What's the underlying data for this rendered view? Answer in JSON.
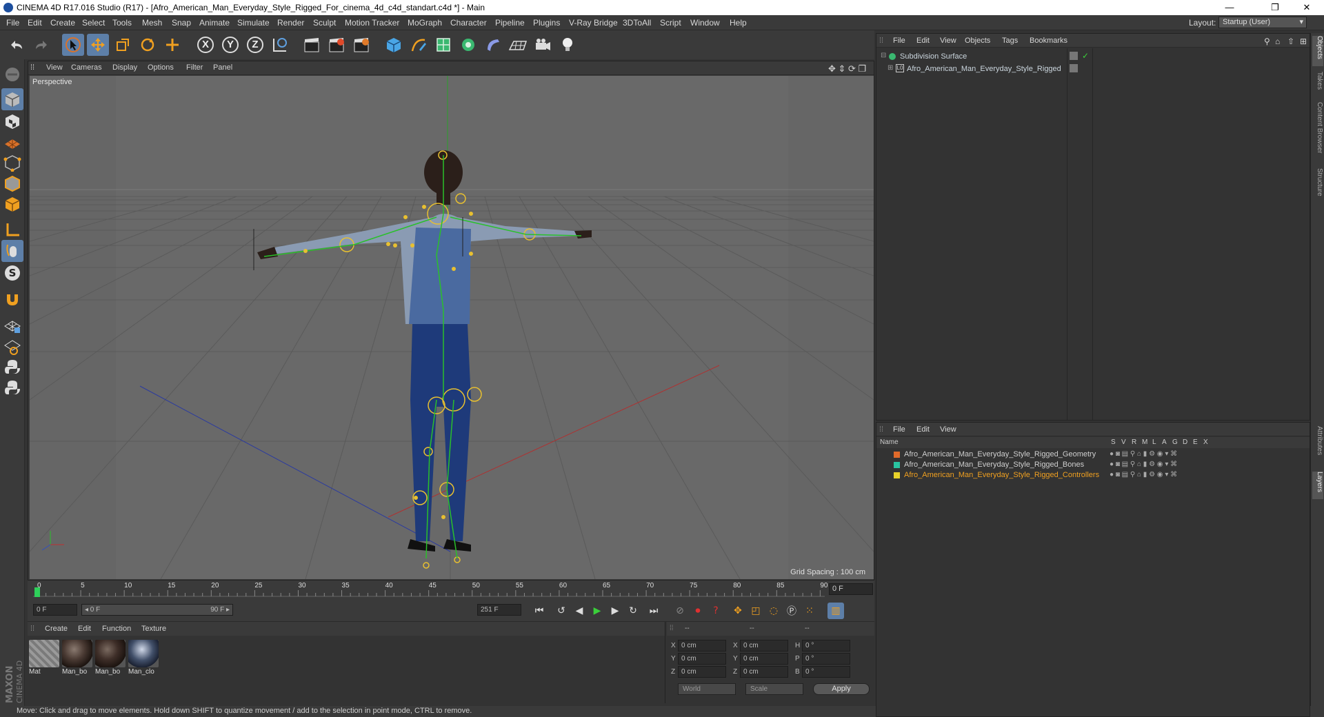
{
  "window": {
    "title": "CINEMA 4D R17.016 Studio (R17) - [Afro_American_Man_Everyday_Style_Rigged_For_cinema_4d_c4d_standart.c4d *] - Main",
    "minimize": "—",
    "maximize": "❐",
    "close": "✕"
  },
  "menubar": {
    "items": [
      "File",
      "Edit",
      "Create",
      "Select",
      "Tools",
      "Mesh",
      "Snap",
      "Animate",
      "Simulate",
      "Render",
      "Sculpt",
      "Motion Tracker",
      "MoGraph",
      "Character",
      "Pipeline",
      "Plugins",
      "V-Ray Bridge",
      "3DToAll",
      "Script",
      "Window",
      "Help"
    ],
    "layout_label": "Layout:",
    "layout_value": "Startup (User)"
  },
  "toolbar": {
    "axis_x": "X",
    "axis_y": "Y",
    "axis_z": "Z"
  },
  "viewport": {
    "menu": [
      "View",
      "Cameras",
      "Display",
      "Options",
      "Filter",
      "Panel"
    ],
    "label": "Perspective",
    "grid_spacing": "Grid Spacing : 100 cm"
  },
  "timeline": {
    "ticks": [
      "0",
      "5",
      "10",
      "15",
      "20",
      "25",
      "30",
      "35",
      "40",
      "45",
      "50",
      "55",
      "60",
      "65",
      "70",
      "75",
      "80",
      "85",
      "90"
    ],
    "current_frame": "0 F"
  },
  "transport": {
    "start_field": "0 F",
    "range_start": "◂ 0 F",
    "range_end": "90 F ▸",
    "end_field": "251 F"
  },
  "materials": {
    "menu": [
      "Create",
      "Edit",
      "Function",
      "Texture"
    ],
    "items": [
      {
        "name": "Mat",
        "color": "#9a9a9a"
      },
      {
        "name": "Man_bo",
        "color": "#4a3a33"
      },
      {
        "name": "Man_bo",
        "color": "#3e2e28"
      },
      {
        "name": "Man_clo",
        "color": "#42506a"
      }
    ]
  },
  "coordinates": {
    "headers": [
      "--",
      "--",
      "--"
    ],
    "rows": [
      {
        "a": "X",
        "av": "0 cm",
        "b": "X",
        "bv": "0 cm",
        "c": "H",
        "cv": "0 °"
      },
      {
        "a": "Y",
        "av": "0 cm",
        "b": "Y",
        "bv": "0 cm",
        "c": "P",
        "cv": "0 °"
      },
      {
        "a": "Z",
        "av": "0 cm",
        "b": "Z",
        "bv": "0 cm",
        "c": "B",
        "cv": "0 °"
      }
    ],
    "mode_world": "World",
    "mode_scale": "Scale",
    "apply": "Apply"
  },
  "brand": {
    "maxon": "MAXON",
    "product": "CINEMA 4D"
  },
  "status": "Move: Click and drag to move elements. Hold down SHIFT to quantize movement / add to the selection in point mode, CTRL to remove.",
  "object_manager": {
    "menu": [
      "File",
      "Edit",
      "View",
      "Objects",
      "Tags",
      "Bookmarks"
    ],
    "objects": [
      {
        "name": "Subdivision Surface"
      },
      {
        "name": "Afro_American_Man_Everyday_Style_Rigged"
      }
    ]
  },
  "layer_manager": {
    "menu": [
      "File",
      "Edit",
      "View"
    ],
    "columns": [
      "Name",
      "S",
      "V",
      "R",
      "M",
      "L",
      "A",
      "G",
      "D",
      "E",
      "X"
    ],
    "layers": [
      {
        "name": "Afro_American_Man_Everyday_Style_Rigged_Geometry",
        "color": "#e06a2a",
        "text_color": "#cfcfcf"
      },
      {
        "name": "Afro_American_Man_Everyday_Style_Rigged_Bones",
        "color": "#29c4a0",
        "text_color": "#cfcfcf"
      },
      {
        "name": "Afro_American_Man_Everyday_Style_Rigged_Controllers",
        "color": "#e8d22a",
        "text_color": "#f0a020"
      }
    ]
  },
  "right_tabs": [
    "Objects",
    "Takes",
    "Content Browser",
    "Structure",
    "Attributes",
    "Layers"
  ],
  "accent_color": "#5d7fa8"
}
